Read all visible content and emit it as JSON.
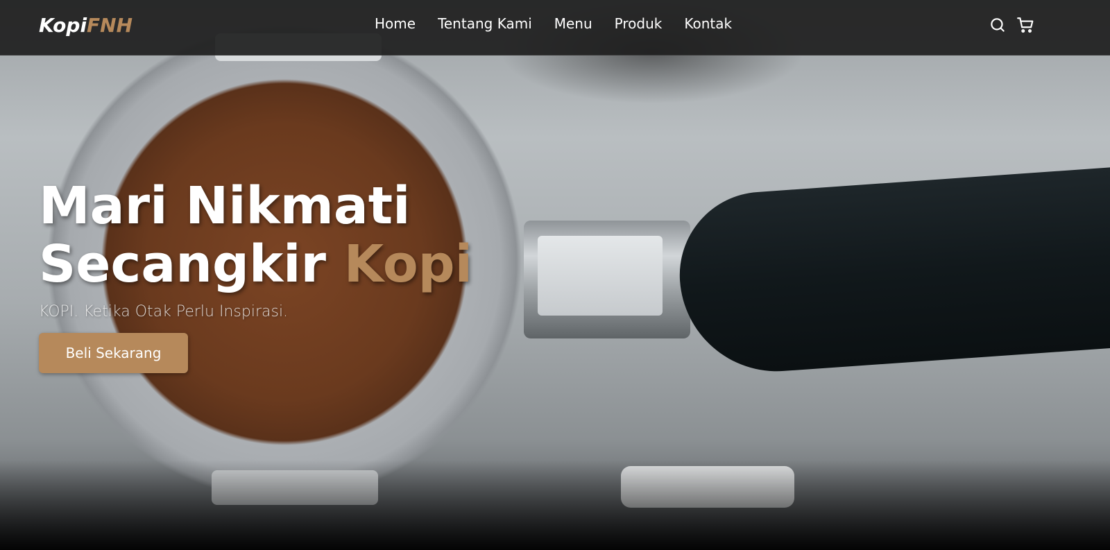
{
  "brand": {
    "logo_part1": "Kopi",
    "logo_part2": "FNH",
    "accent_color": "#b6895b"
  },
  "nav": {
    "items": [
      "Home",
      "Tentang Kami",
      "Menu",
      "Produk",
      "Kontak"
    ]
  },
  "icons": {
    "search": "search-icon",
    "cart": "shopping-cart-icon"
  },
  "hero": {
    "headline_line1": "Mari Nikmati",
    "headline_line2_main": "Secangkir ",
    "headline_line2_accent": "Kopi",
    "tagline": "KOPI. Ketika Otak Perlu Inspirasi.",
    "cta_label": "Beli Sekarang",
    "background": "coffee-portafilter-photo"
  }
}
